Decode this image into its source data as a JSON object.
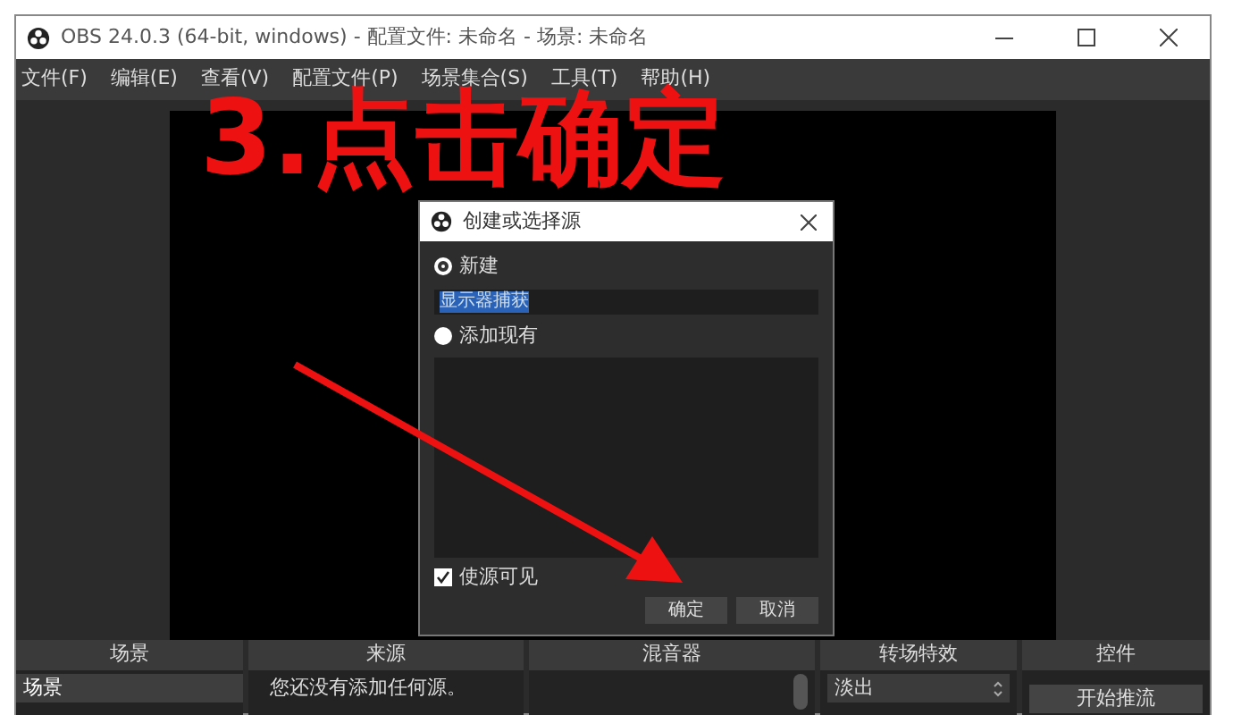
{
  "window": {
    "title": "OBS 24.0.3 (64-bit, windows) - 配置文件: 未命名 - 场景: 未命名"
  },
  "menu": [
    "文件(F)",
    "编辑(E)",
    "查看(V)",
    "配置文件(P)",
    "场景集合(S)",
    "工具(T)",
    "帮助(H)"
  ],
  "dialog": {
    "title": "创建或选择源",
    "options": [
      {
        "label": "新建",
        "selected": true
      },
      {
        "label": "添加现有",
        "selected": false
      }
    ],
    "name_value": "显示器捕获",
    "checkbox": {
      "label": "使源可见",
      "checked": true
    },
    "buttons": [
      "确定",
      "取消"
    ]
  },
  "docks": [
    {
      "kind": "list",
      "title": "场景",
      "items": [
        {
          "label": "场景",
          "selected": true
        }
      ]
    },
    {
      "kind": "text",
      "title": "来源",
      "text": "您还没有添加任何源。"
    },
    {
      "kind": "mixer",
      "title": "混音器"
    },
    {
      "kind": "select",
      "title": "转场特效",
      "value": "淡出"
    },
    {
      "kind": "button",
      "title": "控件",
      "button": "开始推流"
    }
  ],
  "annotation": "3.点击确定"
}
